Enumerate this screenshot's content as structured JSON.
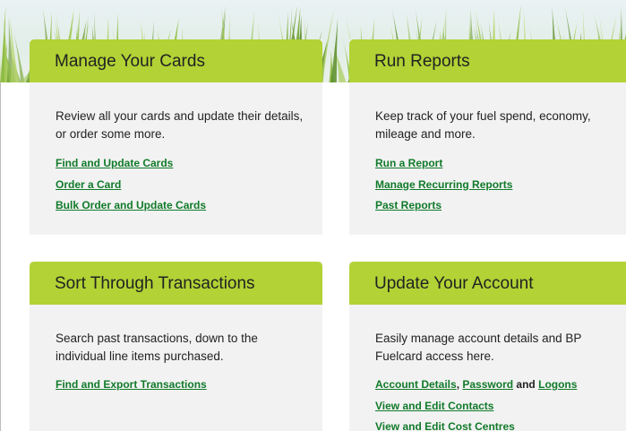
{
  "cards": {
    "manage_cards": {
      "title": "Manage Your Cards",
      "description": "Review all your cards and update their details, or order some more.",
      "links": {
        "find_update": "Find and Update Cards",
        "order": "Order a Card",
        "bulk": "Bulk Order and Update Cards"
      }
    },
    "run_reports": {
      "title": "Run Reports",
      "description": "Keep track of your fuel spend, economy, mileage and more.",
      "links": {
        "run": "Run a Report",
        "recurring": "Manage Recurring Reports",
        "past": "Past Reports"
      }
    },
    "transactions": {
      "title": "Sort Through Transactions",
      "description": "Search past transactions, down to the individual line items purchased.",
      "links": {
        "find_export": "Find and Export Transactions"
      }
    },
    "account": {
      "title": "Update Your Account",
      "description": "Easily manage account details and BP Fuelcard access here.",
      "links": {
        "account_details": "Account Details",
        "separator": ",",
        "password": "Password",
        "and": "and",
        "logons": "Logons",
        "contacts": "View and Edit Contacts",
        "cost_centres": "View and Edit Cost Centres"
      }
    }
  },
  "colors": {
    "header_green": "#b2d235",
    "panel_grey": "#f2f2f2",
    "link_green": "#117a2a"
  },
  "icons": {
    "hero": "grass-banner"
  }
}
